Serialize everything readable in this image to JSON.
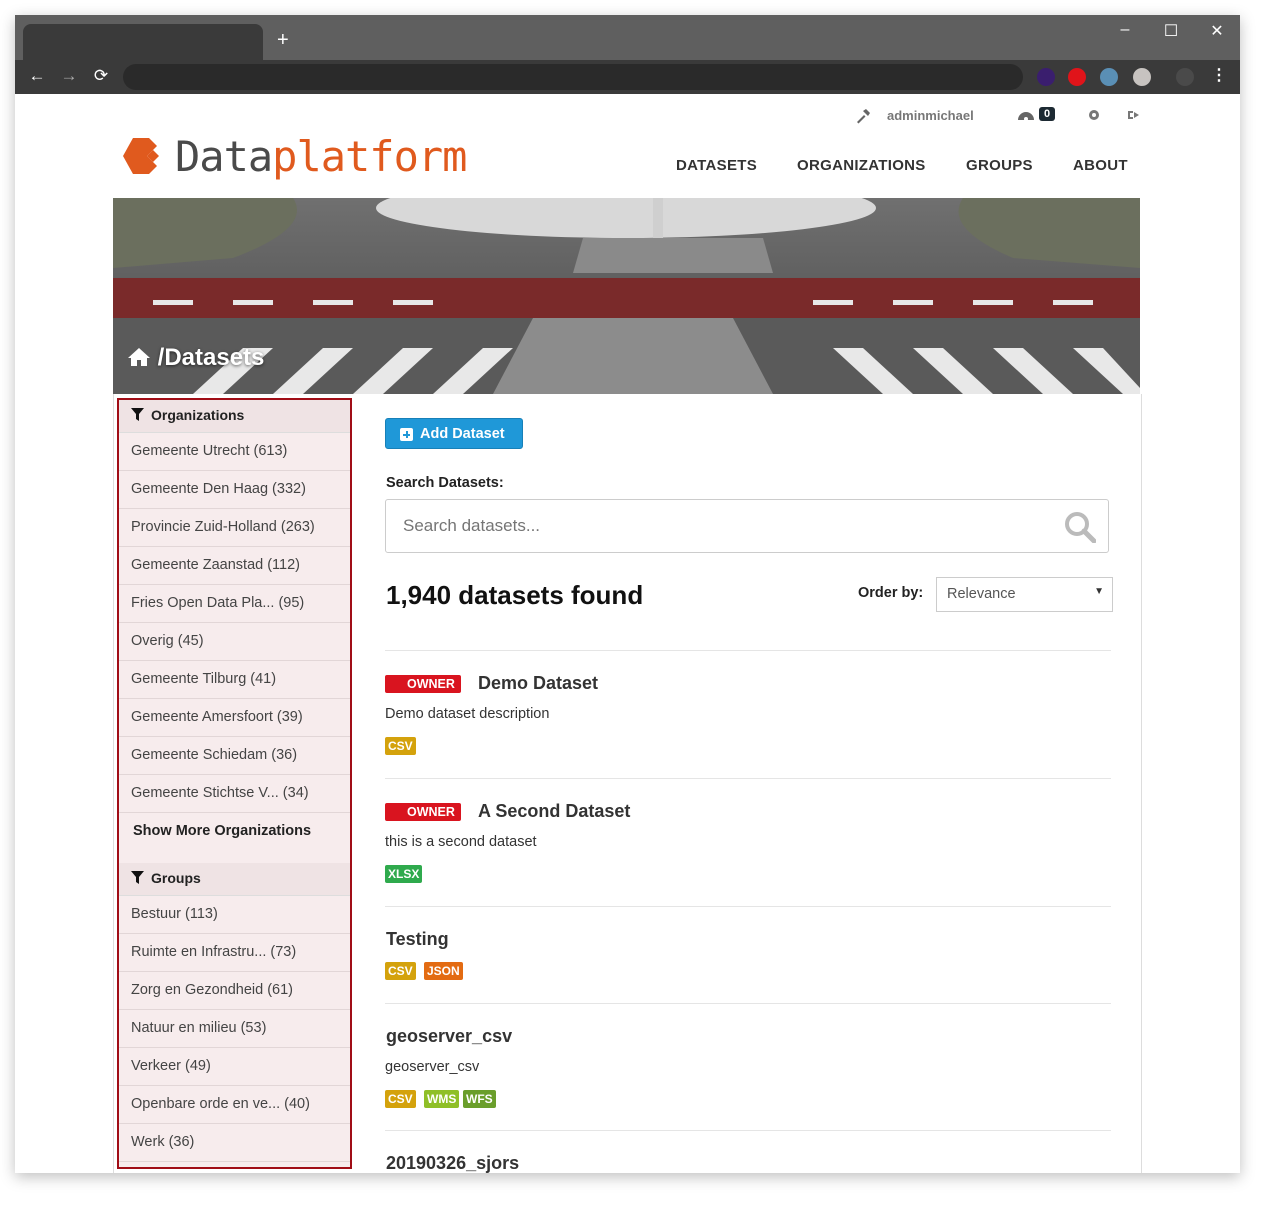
{
  "browser": {
    "new_tab": "+",
    "minimize": "–",
    "maximize": "☐",
    "close": "✕",
    "back": "←",
    "forward": "→",
    "reload": "⟳",
    "menu": "⋮",
    "extension_colors": [
      "#3a1e6e",
      "#e0141a",
      "#5a8fb5",
      "#c7c3c0",
      "#4a4a4a"
    ]
  },
  "topbar": {
    "username": "adminmichael",
    "notifications_count": "0"
  },
  "logo": {
    "part1": "Data",
    "part2": "platform",
    "accent_color": "#e05a1e"
  },
  "nav": {
    "datasets": "DATASETS",
    "organizations": "ORGANIZATIONS",
    "groups": "GROUPS",
    "about": "ABOUT"
  },
  "breadcrumb": {
    "separator": "/",
    "current": "Datasets"
  },
  "facets": {
    "organizations_title": "Organizations",
    "organizations": [
      "Gemeente Utrecht (613)",
      "Gemeente Den Haag (332)",
      "Provincie Zuid-Holland (263)",
      "Gemeente Zaanstad (112)",
      "Fries Open Data Pla... (95)",
      "Overig (45)",
      "Gemeente Tilburg (41)",
      "Gemeente Amersfoort (39)",
      "Gemeente Schiedam (36)",
      "Gemeente Stichtse V... (34)"
    ],
    "show_more_orgs": "Show More Organizations",
    "groups_title": "Groups",
    "groups": [
      "Bestuur (113)",
      "Ruimte en Infrastru... (73)",
      "Zorg en Gezondheid (61)",
      "Natuur en milieu (53)",
      "Verkeer (49)",
      "Openbare orde en ve... (40)",
      "Werk (36)"
    ]
  },
  "main": {
    "add_dataset": "Add Dataset",
    "search_label": "Search Datasets:",
    "search_placeholder": "Search datasets...",
    "found_text": "1,940 datasets found",
    "order_label": "Order by:",
    "order_value": "Relevance"
  },
  "datasets": [
    {
      "owner": "OWNER",
      "title": "Demo Dataset",
      "description": "Demo dataset description",
      "formats": [
        "CSV"
      ]
    },
    {
      "owner": "OWNER",
      "title": "A Second Dataset",
      "description": "this is a second dataset",
      "formats": [
        "XLSX"
      ]
    },
    {
      "title": "Testing",
      "formats": [
        "CSV",
        "JSON"
      ]
    },
    {
      "title": "geoserver_csv",
      "description": "geoserver_csv",
      "formats": [
        "CSV",
        "WMS",
        "WFS"
      ]
    },
    {
      "title": "20190326_sjors"
    }
  ],
  "format_colors": {
    "CSV": "#d4a20c",
    "XLSX": "#2faa4d",
    "JSON": "#e36b12",
    "WMS": "#8fbf27",
    "WFS": "#6a9e2b"
  }
}
